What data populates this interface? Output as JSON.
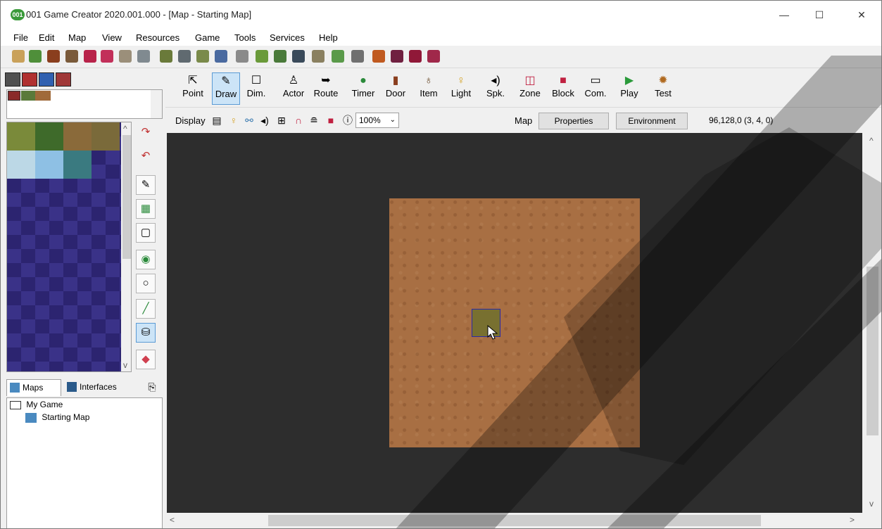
{
  "window": {
    "title": "001 Game Creator 2020.001.000 - [Map - Starting Map]",
    "app_icon": "001",
    "controls": {
      "minimize": "—",
      "maximize": "☐",
      "close": "✕"
    }
  },
  "menu": [
    "File",
    "Edit",
    "Map",
    "View",
    "Resources",
    "Game",
    "Tools",
    "Services",
    "Help"
  ],
  "map_tools": [
    {
      "label": "Point",
      "icon": "pointer-icon"
    },
    {
      "label": "Draw",
      "icon": "pencil-icon"
    },
    {
      "label": "Dim.",
      "icon": "square-icon"
    },
    {
      "label": "Actor",
      "icon": "actor-icon"
    },
    {
      "label": "Route",
      "icon": "route-icon"
    },
    {
      "label": "Timer",
      "icon": "timer-icon"
    },
    {
      "label": "Door",
      "icon": "door-icon"
    },
    {
      "label": "Item",
      "icon": "item-bag-icon"
    },
    {
      "label": "Light",
      "icon": "lightbulb-icon"
    },
    {
      "label": "Spk.",
      "icon": "speaker-icon"
    },
    {
      "label": "Zone",
      "icon": "zone-icon"
    },
    {
      "label": "Block",
      "icon": "block-icon"
    },
    {
      "label": "Com.",
      "icon": "comment-icon"
    },
    {
      "label": "Play",
      "icon": "play-icon"
    },
    {
      "label": "Test",
      "icon": "test-icon"
    }
  ],
  "active_tool": "Draw",
  "display_bar": {
    "label": "Display",
    "zoom": "100%",
    "map_label": "Map",
    "properties_button": "Properties",
    "environment_button": "Environment",
    "coordinates": "96,128,0 (3, 4, 0)"
  },
  "left_tabs": {
    "maps": "Maps",
    "interfaces": "Interfaces"
  },
  "tree": {
    "root": "My Game",
    "child": "Starting Map"
  },
  "colors": {
    "accent_blue": "#5b9bd5",
    "viewport_bg": "#2d2d2d",
    "map_dirt": "#a86f43",
    "palette_dark": "#2c2470"
  }
}
